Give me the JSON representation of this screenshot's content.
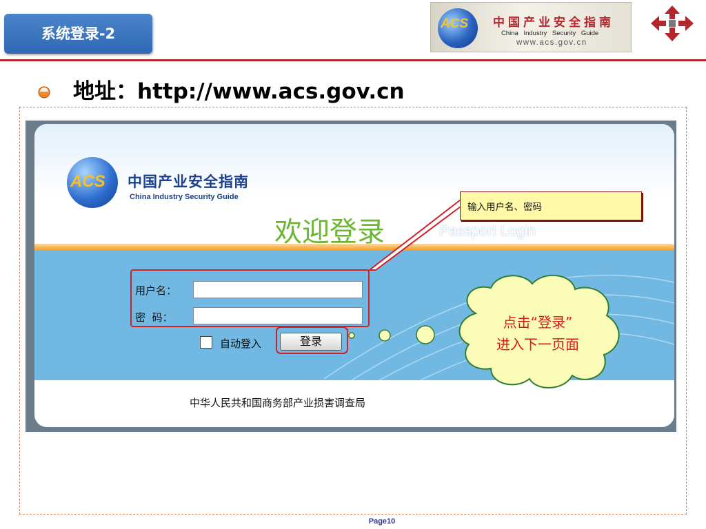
{
  "slide": {
    "title": "系统登录-2",
    "heading": "地址：http://www.acs.gov.cn",
    "page_number": "Page10"
  },
  "header_logo": {
    "acs": "ACS",
    "name_cn": "中国产业安全指南",
    "name_en": "China  Industry  Security  Guide",
    "url": "www.acs.gov.cn"
  },
  "login_page": {
    "logo_acs": "ACS",
    "site_name_cn": "中国产业安全指南",
    "site_name_en": "China Industry  Security Guide",
    "welcome": "欢迎登录",
    "passport": "Passport Login",
    "username_label": "用户名：",
    "password_label": "密  码：",
    "username_value": "",
    "password_value": "",
    "auto_login_label": "自动登入",
    "auto_login_checked": false,
    "login_button": "登录",
    "footer_org": "中华人民共和国商务部产业损害调查局"
  },
  "annotations": {
    "callout": "输入用户名、密码",
    "cloud_line1": "点击“登录”",
    "cloud_line2": "进入下一页面"
  },
  "colors": {
    "title_bg": "#3a75c1",
    "rule_red": "#b3262c",
    "highlight_red": "#d11f26",
    "welcome_green": "#6cb633",
    "panel_blue": "#71b9e3",
    "cloud_fill": "#fbfcb8",
    "page_num": "#2e3a8c"
  }
}
